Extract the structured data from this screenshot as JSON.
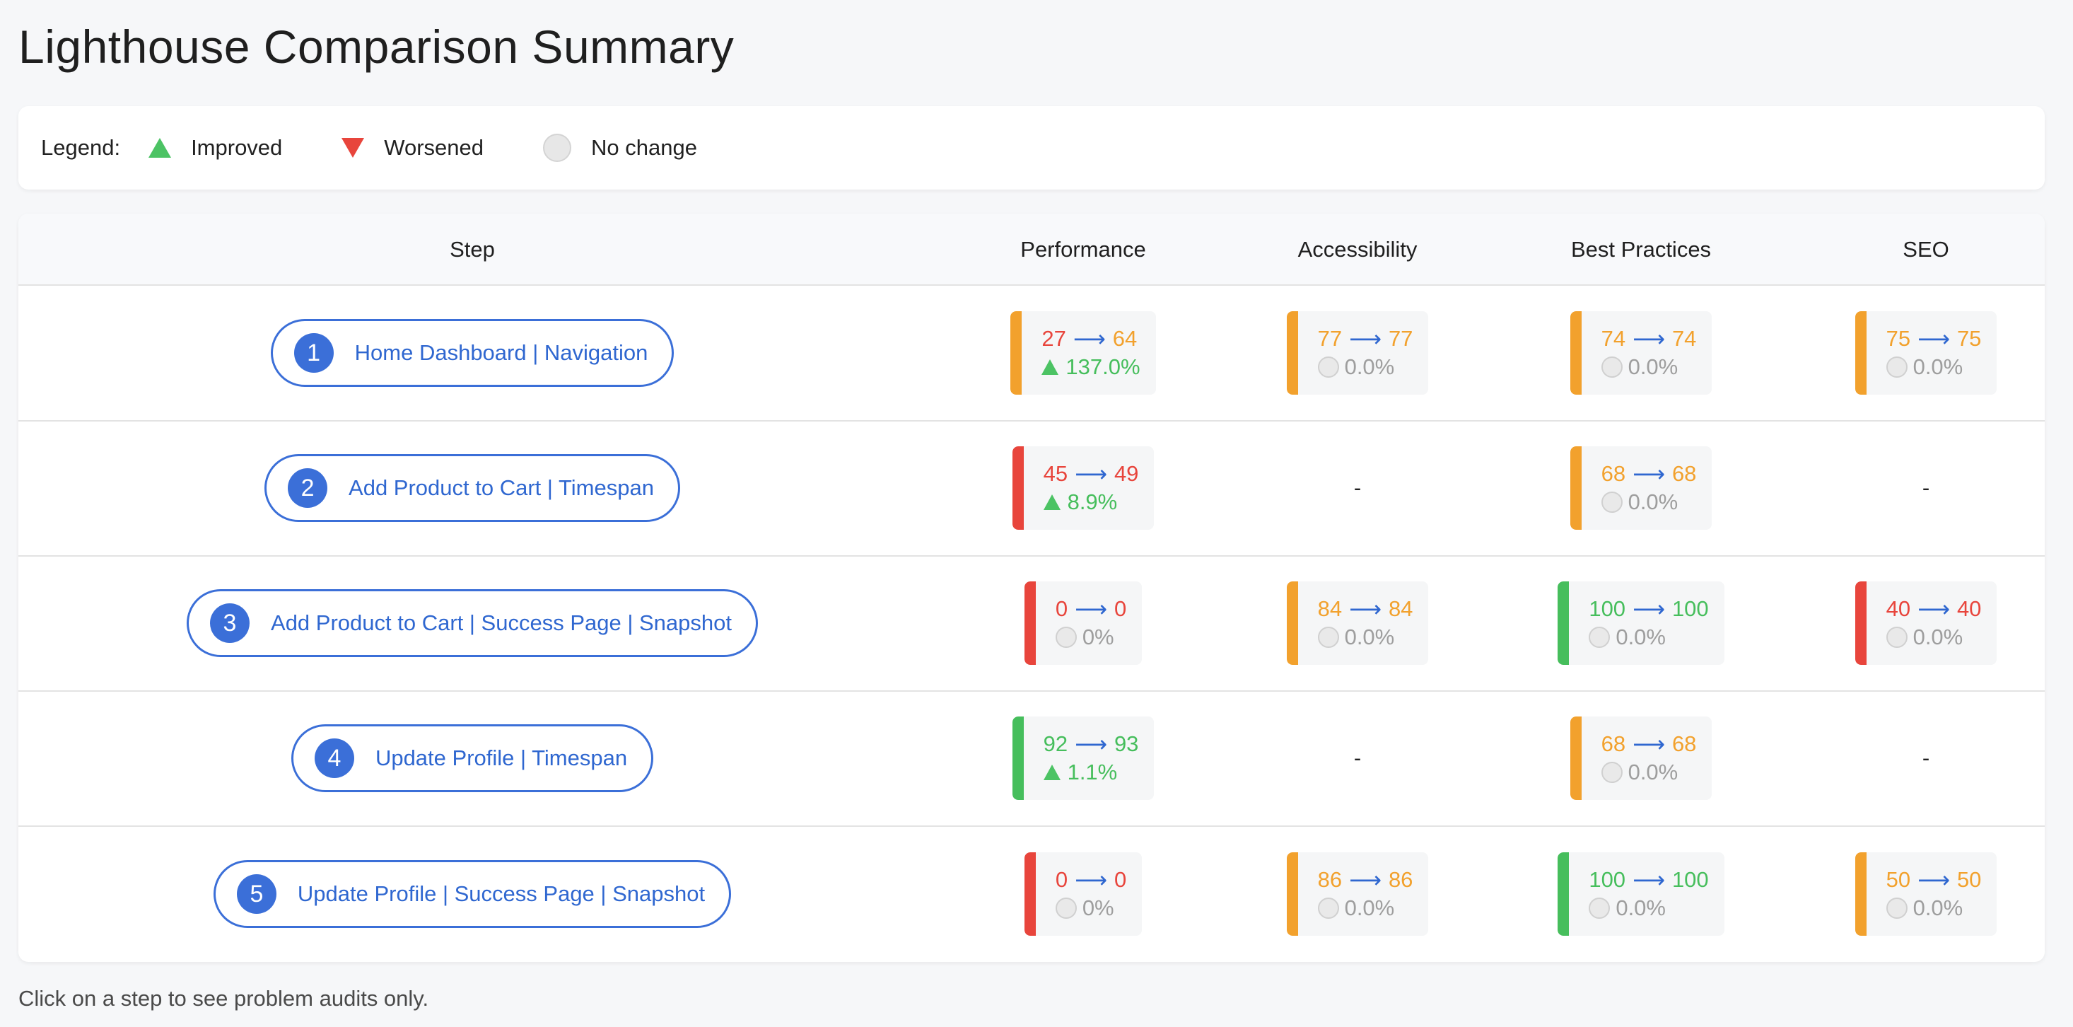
{
  "title": "Lighthouse Comparison Summary",
  "legend": {
    "label": "Legend:",
    "improved": "Improved",
    "worsened": "Worsened",
    "no_change": "No change"
  },
  "columns": {
    "step": "Step",
    "performance": "Performance",
    "accessibility": "Accessibility",
    "best_practices": "Best Practices",
    "seo": "SEO"
  },
  "arrow": "⟶",
  "empty": "-",
  "rows": [
    {
      "num": "1",
      "name": "Home Dashboard | Navigation",
      "performance": {
        "from": "27",
        "to": "64",
        "delta": "137.0%"
      },
      "accessibility": {
        "from": "77",
        "to": "77",
        "delta": "0.0%"
      },
      "best_practices": {
        "from": "74",
        "to": "74",
        "delta": "0.0%"
      },
      "seo": {
        "from": "75",
        "to": "75",
        "delta": "0.0%"
      }
    },
    {
      "num": "2",
      "name": "Add Product to Cart | Timespan",
      "performance": {
        "from": "45",
        "to": "49",
        "delta": "8.9%"
      },
      "best_practices": {
        "from": "68",
        "to": "68",
        "delta": "0.0%"
      }
    },
    {
      "num": "3",
      "name": "Add Product to Cart | Success Page | Snapshot",
      "performance": {
        "from": "0",
        "to": "0",
        "delta": "0%"
      },
      "accessibility": {
        "from": "84",
        "to": "84",
        "delta": "0.0%"
      },
      "best_practices": {
        "from": "100",
        "to": "100",
        "delta": "0.0%"
      },
      "seo": {
        "from": "40",
        "to": "40",
        "delta": "0.0%"
      }
    },
    {
      "num": "4",
      "name": "Update Profile | Timespan",
      "performance": {
        "from": "92",
        "to": "93",
        "delta": "1.1%"
      },
      "best_practices": {
        "from": "68",
        "to": "68",
        "delta": "0.0%"
      }
    },
    {
      "num": "5",
      "name": "Update Profile | Success Page | Snapshot",
      "performance": {
        "from": "0",
        "to": "0",
        "delta": "0%"
      },
      "accessibility": {
        "from": "86",
        "to": "86",
        "delta": "0.0%"
      },
      "best_practices": {
        "from": "100",
        "to": "100",
        "delta": "0.0%"
      },
      "seo": {
        "from": "50",
        "to": "50",
        "delta": "0.0%"
      }
    }
  ],
  "footer": "Click on a step to see problem audits only.",
  "colors": {
    "accent": "#3b6fd8",
    "poor": "#e8453c",
    "average": "#f2a12d",
    "good": "#46be5c",
    "neutral": "#9e9e9e"
  }
}
